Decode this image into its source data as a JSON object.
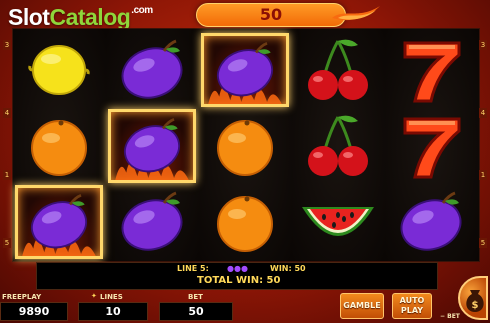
{
  "logo": {
    "part1": "Slot",
    "part2": "Catalog",
    "part3": ".com"
  },
  "header": {
    "win_display": "50"
  },
  "reels": [
    [
      "lemon",
      "orange",
      "plum"
    ],
    [
      "plum",
      "plum",
      "plum"
    ],
    [
      "plum",
      "orange",
      "orange"
    ],
    [
      "cherry",
      "cherry",
      "watermelon"
    ],
    [
      "seven",
      "seven",
      "plum"
    ]
  ],
  "highlighted": [
    "0-2",
    "1-1",
    "2-0"
  ],
  "side_numbers": {
    "left": [
      "3",
      "4",
      "1",
      "5"
    ],
    "right": [
      "3",
      "4",
      "1",
      "5"
    ]
  },
  "info": {
    "line_label": "LINE 5:",
    "win_label": "WIN: 50",
    "total_win": "TOTAL WIN: 50"
  },
  "controls": {
    "freeplay_label": "FREEPLAY",
    "freeplay_value": "9890",
    "lines_label": "LINES",
    "lines_value": "10",
    "bet_label": "BET",
    "bet_value": "50",
    "gamble": "GAMBLE",
    "autoplay_1": "AUTO",
    "autoplay_2": "PLAY",
    "bet_minus": "− BET"
  },
  "colors": {
    "accent": "#ffd95a",
    "button": "#f28a1d",
    "plum": "#7a2bd6",
    "background": "#8e1606"
  }
}
